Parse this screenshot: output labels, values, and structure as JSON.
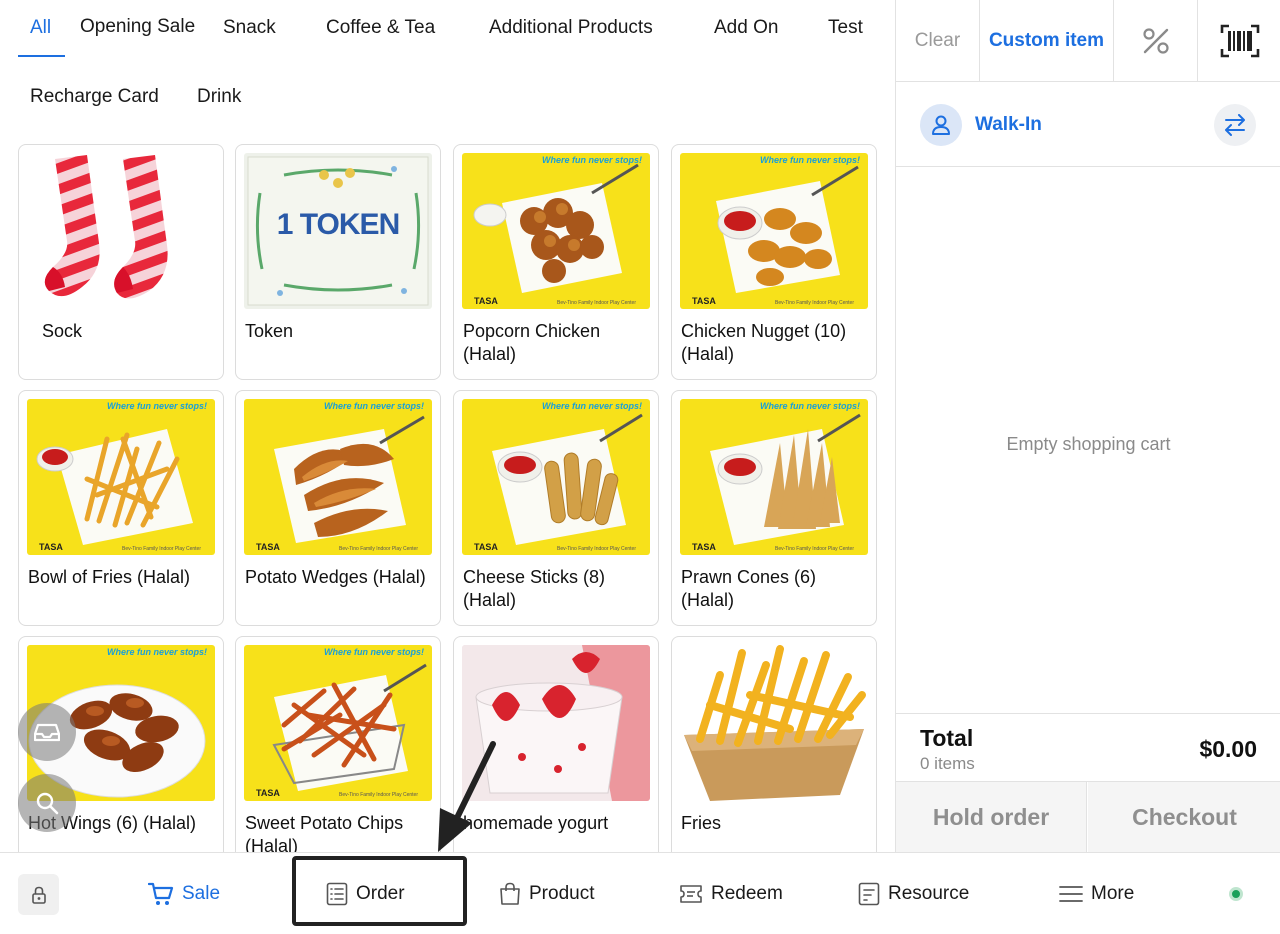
{
  "categories": [
    {
      "label": "All",
      "active": true
    },
    {
      "label": "Opening Sale"
    },
    {
      "label": "Snack"
    },
    {
      "label": "Coffee & Tea"
    },
    {
      "label": "Additional Products"
    },
    {
      "label": "Add On"
    },
    {
      "label": "Test"
    },
    {
      "label": "Recharge Card"
    },
    {
      "label": "Drink"
    }
  ],
  "products": [
    {
      "name": "Sock"
    },
    {
      "name": "Token",
      "image_text": "1 TOKEN"
    },
    {
      "name": "Popcorn Chicken (Halal)"
    },
    {
      "name": "Chicken Nugget (10) (Halal)"
    },
    {
      "name": "Bowl of Fries (Halal)"
    },
    {
      "name": "Potato Wedges (Halal)"
    },
    {
      "name": "Cheese Sticks (8) (Halal)"
    },
    {
      "name": "Prawn Cones (6) (Halal)"
    },
    {
      "name": "Hot Wings (6) (Halal)"
    },
    {
      "name": "Sweet Potato Chips (Halal)"
    },
    {
      "name": "homemade yogurt"
    },
    {
      "name": "Fries"
    }
  ],
  "image_overlay": {
    "tagline": "Where fun never stops!",
    "brand": "TASA",
    "fine_print": "Bev-Tino Family Indoor Play Center"
  },
  "cart": {
    "clear_label": "Clear",
    "custom_item_label": "Custom item",
    "customer": "Walk-In",
    "empty_text": "Empty shopping cart",
    "total_label": "Total",
    "items_count": "0 items",
    "total_value": "$0.00",
    "hold_label": "Hold order",
    "checkout_label": "Checkout"
  },
  "bottom_nav": {
    "sale": "Sale",
    "order": "Order",
    "product": "Product",
    "redeem": "Redeem",
    "resource": "Resource",
    "more": "More"
  },
  "colors": {
    "accent": "#1d6fe0",
    "image_bg": "#f7e11a",
    "status_online": "#1aa05a"
  }
}
